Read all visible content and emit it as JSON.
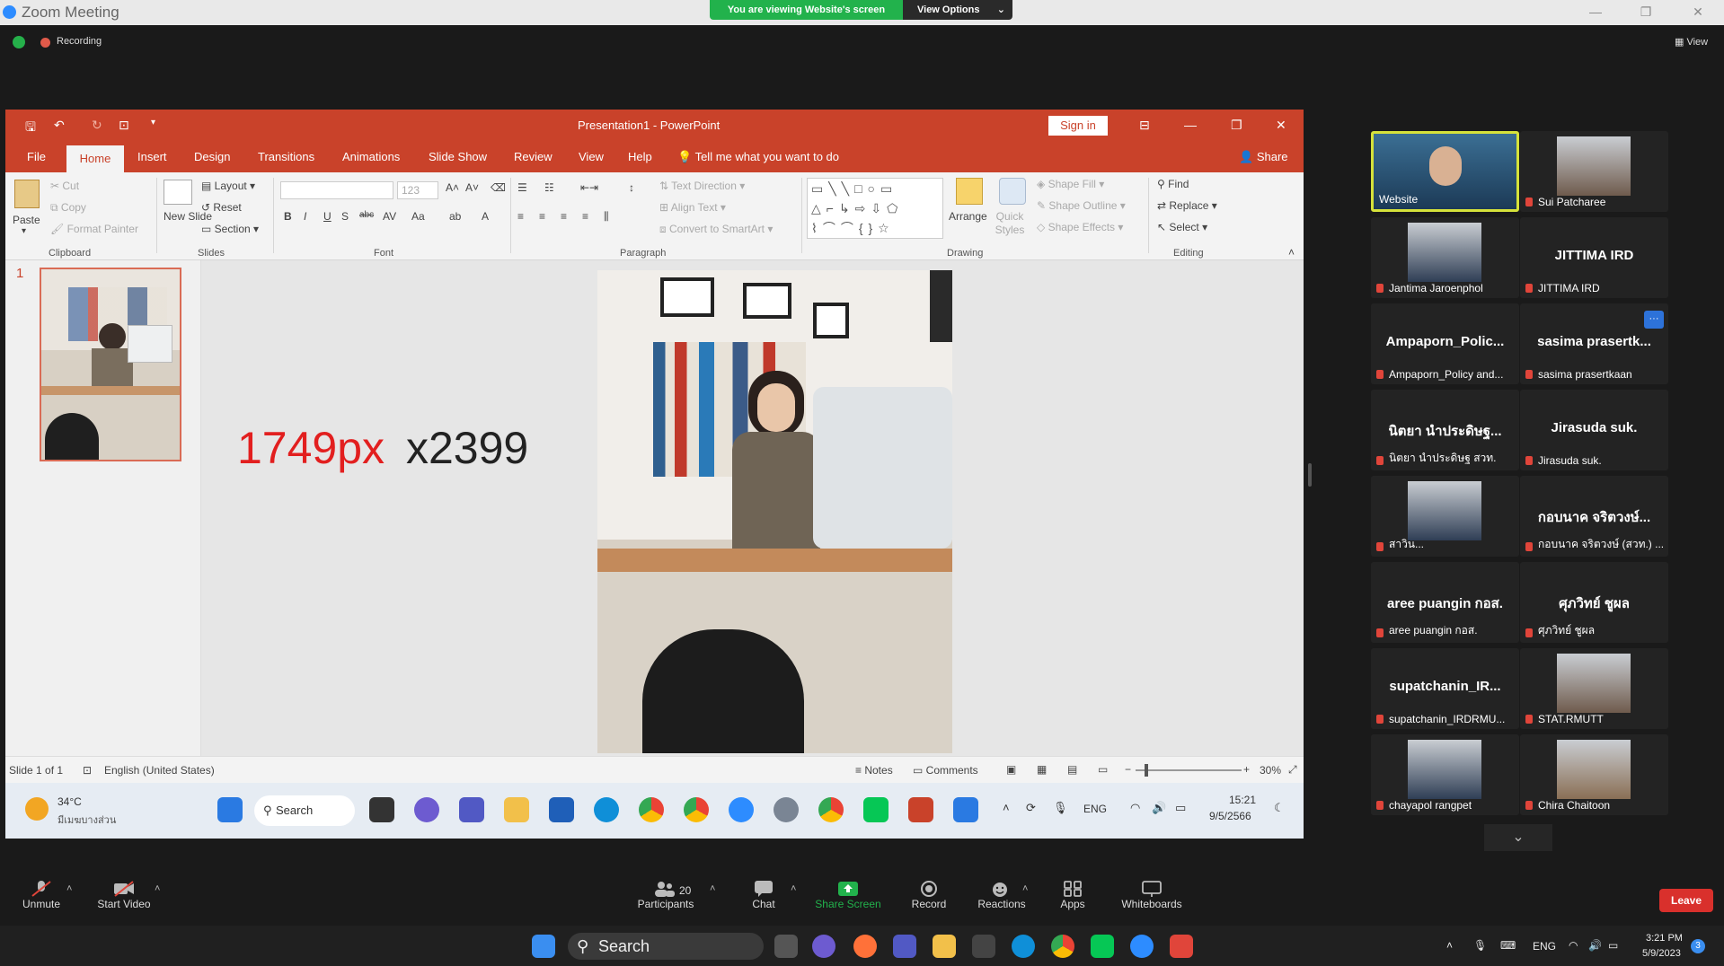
{
  "zoom": {
    "title": "Zoom Meeting",
    "share_banner": "You are viewing Website's screen",
    "view_options": "View Options",
    "recording": "Recording",
    "view": "View"
  },
  "ppt": {
    "title": "Presentation1  -  PowerPoint",
    "sign_in": "Sign in",
    "share": "Share",
    "tabs": [
      "File",
      "Home",
      "Insert",
      "Design",
      "Transitions",
      "Animations",
      "Slide Show",
      "Review",
      "View",
      "Help"
    ],
    "tell_me": "Tell me what you want to do",
    "clipboard": {
      "paste": "Paste",
      "cut": "Cut",
      "copy": "Copy",
      "format_painter": "Format Painter",
      "group": "Clipboard"
    },
    "slides": {
      "new_slide": "New Slide",
      "layout": "Layout",
      "reset": "Reset",
      "section": "Section",
      "group": "Slides"
    },
    "font": {
      "size": "123",
      "group": "Font"
    },
    "paragraph": {
      "text_direction": "Text Direction",
      "align_text": "Align Text",
      "convert": "Convert to SmartArt",
      "group": "Paragraph"
    },
    "drawing": {
      "arrange": "Arrange",
      "quick_styles": "Quick Styles",
      "shape_fill": "Shape Fill",
      "shape_outline": "Shape Outline",
      "shape_effects": "Shape Effects",
      "group": "Drawing"
    },
    "editing": {
      "find": "Find",
      "replace": "Replace",
      "select": "Select",
      "group": "Editing"
    },
    "slide_number": "1",
    "slide_text_a": "1749px",
    "slide_text_b": "x2399",
    "status": {
      "slide": "Slide 1 of 1",
      "language": "English (United States)",
      "notes": "Notes",
      "comments": "Comments",
      "zoom": "30%"
    }
  },
  "inner_taskbar": {
    "temp": "34°C",
    "weather": "มีเมฆบางส่วน",
    "search": "Search",
    "lang": "ENG",
    "time": "15:21",
    "date": "9/5/2566"
  },
  "participants": [
    {
      "name": "Website",
      "type": "video"
    },
    {
      "name": "Sui Patcharee",
      "type": "photo"
    },
    {
      "name": "Jantima Jaroenphol",
      "type": "photo"
    },
    {
      "name": "JITTIMA IRD",
      "big": "JITTIMA IRD"
    },
    {
      "name": "Ampaporn_Policy and...",
      "big": "Ampaporn_Polic..."
    },
    {
      "name": "sasima prasertkaan",
      "big": "sasima prasertk..."
    },
    {
      "name": "นิตยา นำประดิษฐ สวท.",
      "big": "นิตยา นำประดิษฐ..."
    },
    {
      "name": "Jirasuda suk.",
      "big": "Jirasuda suk."
    },
    {
      "name": "สาวิน...",
      "type": "photo"
    },
    {
      "name": "กอบนาค จริตวงษ์ (สวท.) ...",
      "big": "กอบนาค จริตวงษ์..."
    },
    {
      "name": "aree puangin กอส.",
      "big": "aree  puangin กอส."
    },
    {
      "name": "ศุภวิทย์ ชูผล",
      "big": "ศุภวิทย์ ชูผล"
    },
    {
      "name": "supatchanin_IRDRMU...",
      "big": "supatchanin_IR..."
    },
    {
      "name": "STAT.RMUTT",
      "type": "photo"
    },
    {
      "name": "chayapol rangpet",
      "type": "photo"
    },
    {
      "name": "Chira Chaitoon",
      "type": "photo"
    }
  ],
  "toolbar": {
    "unmute": "Unmute",
    "start_video": "Start Video",
    "participants": "Participants",
    "participants_count": "20",
    "chat": "Chat",
    "share_screen": "Share Screen",
    "record": "Record",
    "reactions": "Reactions",
    "apps": "Apps",
    "whiteboards": "Whiteboards",
    "leave": "Leave"
  },
  "taskbar": {
    "search": "Search",
    "lang": "ENG",
    "time": "3:21 PM",
    "date": "5/9/2023",
    "badge": "3"
  },
  "colors": {
    "ppt_red": "#c9422a",
    "zoom_green": "#22b24c",
    "leave_red": "#d9302c"
  }
}
